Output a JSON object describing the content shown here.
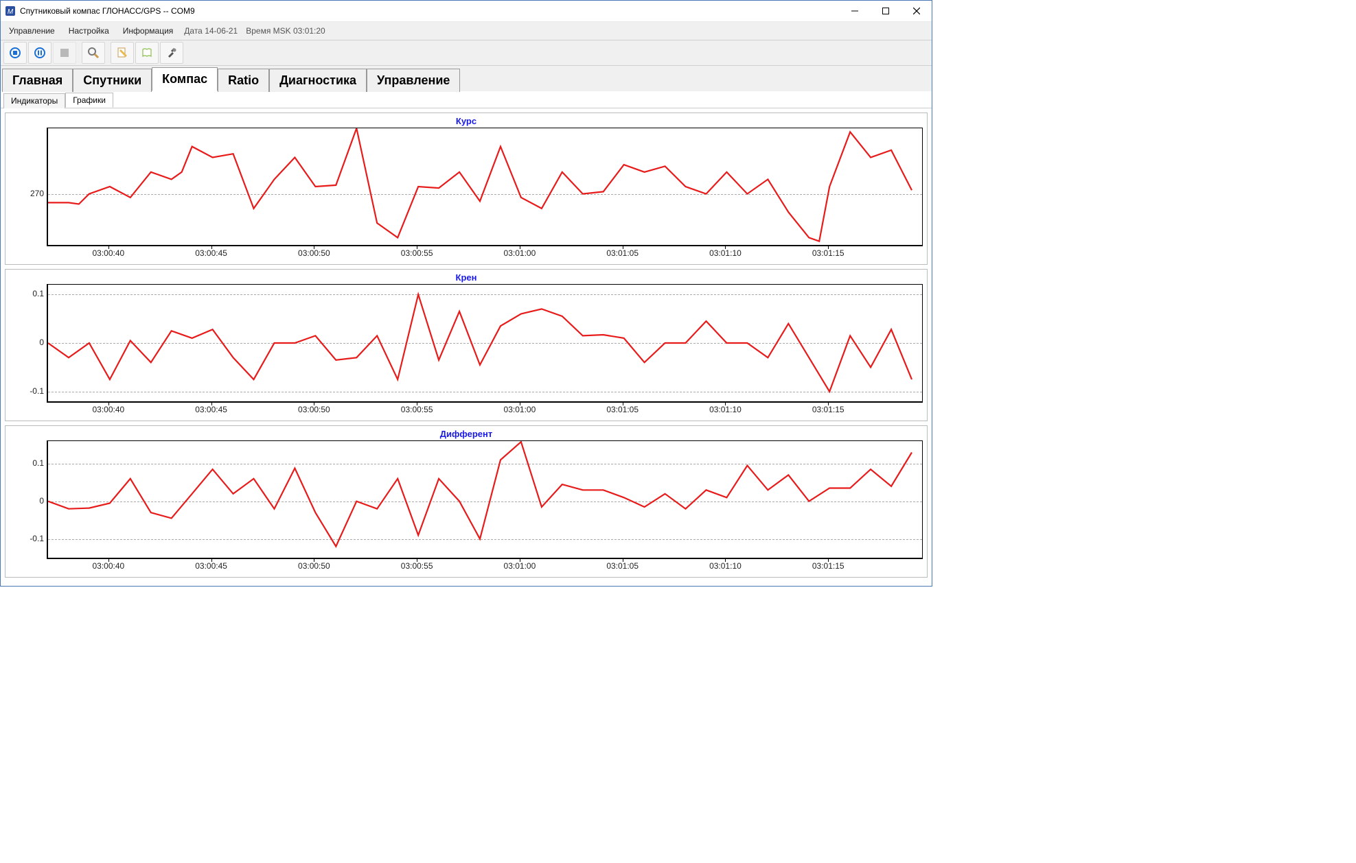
{
  "window": {
    "title": "Спутниковый компас ГЛОНАСС/GPS -- COM9"
  },
  "menu": {
    "control": "Управление",
    "settings": "Настройка",
    "info": "Информация",
    "date": "Дата 14-06-21",
    "time": "Время MSK 03:01:20"
  },
  "main_tabs": {
    "home": "Главная",
    "sat": "Спутники",
    "compass": "Компас",
    "ratio": "Ratio",
    "diag": "Диагностика",
    "ctrl": "Управление"
  },
  "sub_tabs": {
    "indicators": "Индикаторы",
    "charts": "Графики"
  },
  "chart_titles": {
    "heading": "Курс",
    "roll": "Крен",
    "pitch": "Дифферент"
  },
  "chart_data": [
    {
      "type": "line",
      "title": "Курс",
      "xlabel": "",
      "ylabel": "",
      "ylim": [
        200,
        360
      ],
      "y_ticks": [
        270
      ],
      "x_ticks": [
        "03:00:40",
        "03:00:45",
        "03:00:50",
        "03:00:55",
        "03:01:00",
        "03:01:05",
        "03:01:10",
        "03:01:15"
      ],
      "x": [
        "03:00:37",
        "03:00:38",
        "03:00:38.5",
        "03:00:39",
        "03:00:40",
        "03:00:41",
        "03:00:42",
        "03:00:43",
        "03:00:43.5",
        "03:00:44",
        "03:00:45",
        "03:00:46",
        "03:00:47",
        "03:00:48",
        "03:00:49",
        "03:00:50",
        "03:00:51",
        "03:00:52",
        "03:00:53",
        "03:00:54",
        "03:00:55",
        "03:00:56",
        "03:00:57",
        "03:00:58",
        "03:00:59",
        "03:01:00",
        "03:01:01",
        "03:01:02",
        "03:01:03",
        "03:01:04",
        "03:01:05",
        "03:01:06",
        "03:01:07",
        "03:01:08",
        "03:01:09",
        "03:01:10",
        "03:01:11",
        "03:01:12",
        "03:01:13",
        "03:01:14",
        "03:01:14.5",
        "03:01:15",
        "03:01:16",
        "03:01:17",
        "03:01:18",
        "03:01:19"
      ],
      "values": [
        258,
        258,
        256,
        270,
        280,
        265,
        300,
        290,
        300,
        335,
        320,
        325,
        250,
        290,
        320,
        280,
        282,
        360,
        230,
        210,
        280,
        278,
        300,
        260,
        335,
        265,
        250,
        300,
        270,
        273,
        310,
        300,
        308,
        280,
        270,
        300,
        270,
        290,
        245,
        210,
        205,
        280,
        355,
        320,
        330,
        275
      ]
    },
    {
      "type": "line",
      "title": "Крен",
      "xlabel": "",
      "ylabel": "",
      "ylim": [
        -0.12,
        0.12
      ],
      "y_ticks": [
        -0.1,
        0,
        0.1
      ],
      "x_ticks": [
        "03:00:40",
        "03:00:45",
        "03:00:50",
        "03:00:55",
        "03:01:00",
        "03:01:05",
        "03:01:10",
        "03:01:15"
      ],
      "x": [
        "03:00:37",
        "03:00:38",
        "03:00:39",
        "03:00:40",
        "03:00:41",
        "03:00:42",
        "03:00:43",
        "03:00:44",
        "03:00:45",
        "03:00:46",
        "03:00:47",
        "03:00:48",
        "03:00:49",
        "03:00:50",
        "03:00:51",
        "03:00:52",
        "03:00:53",
        "03:00:54",
        "03:00:55",
        "03:00:56",
        "03:00:57",
        "03:00:58",
        "03:00:59",
        "03:01:00",
        "03:01:01",
        "03:01:02",
        "03:01:03",
        "03:01:04",
        "03:01:05",
        "03:01:06",
        "03:01:07",
        "03:01:08",
        "03:01:09",
        "03:01:10",
        "03:01:11",
        "03:01:12",
        "03:01:13",
        "03:01:14",
        "03:01:15",
        "03:01:16",
        "03:01:17",
        "03:01:18",
        "03:01:19"
      ],
      "values": [
        0,
        -0.03,
        0,
        -0.075,
        0.005,
        -0.04,
        0.025,
        0.01,
        0.028,
        -0.03,
        -0.075,
        0,
        0,
        0.015,
        -0.035,
        -0.03,
        0.015,
        -0.075,
        0.1,
        -0.035,
        0.065,
        -0.045,
        0.035,
        0.06,
        0.07,
        0.055,
        0.015,
        0.017,
        0.01,
        -0.04,
        0.0,
        0.0,
        0.045,
        0.0,
        0.0,
        -0.03,
        0.04,
        -0.03,
        -0.1,
        0.015,
        -0.05,
        0.028,
        -0.075
      ]
    },
    {
      "type": "line",
      "title": "Дифферент",
      "xlabel": "",
      "ylabel": "",
      "ylim": [
        -0.15,
        0.16
      ],
      "y_ticks": [
        -0.1,
        0,
        0.1
      ],
      "x_ticks": [
        "03:00:40",
        "03:00:45",
        "03:00:50",
        "03:00:55",
        "03:01:00",
        "03:01:05",
        "03:01:10",
        "03:01:15"
      ],
      "x": [
        "03:00:37",
        "03:00:38",
        "03:00:39",
        "03:00:40",
        "03:00:41",
        "03:00:42",
        "03:00:43",
        "03:00:44",
        "03:00:45",
        "03:00:46",
        "03:00:47",
        "03:00:48",
        "03:00:49",
        "03:00:50",
        "03:00:51",
        "03:00:52",
        "03:00:53",
        "03:00:54",
        "03:00:55",
        "03:00:56",
        "03:00:57",
        "03:00:58",
        "03:00:59",
        "03:01:00",
        "03:01:01",
        "03:01:02",
        "03:01:03",
        "03:01:04",
        "03:01:05",
        "03:01:06",
        "03:01:07",
        "03:01:08",
        "03:01:09",
        "03:01:10",
        "03:01:11",
        "03:01:12",
        "03:01:13",
        "03:01:14",
        "03:01:15",
        "03:01:16",
        "03:01:17",
        "03:01:18",
        "03:01:19"
      ],
      "values": [
        0,
        -0.02,
        -0.018,
        -0.005,
        0.06,
        -0.03,
        -0.045,
        0.02,
        0.085,
        0.02,
        0.06,
        -0.02,
        0.088,
        -0.03,
        -0.12,
        0.0,
        -0.02,
        0.06,
        -0.09,
        0.06,
        0.0,
        -0.1,
        0.11,
        0.158,
        -0.015,
        0.045,
        0.03,
        0.03,
        0.01,
        -0.015,
        0.02,
        -0.02,
        0.03,
        0.01,
        0.095,
        0.03,
        0.07,
        0.0,
        0.035,
        0.035,
        0.085,
        0.04,
        0.13
      ]
    }
  ]
}
